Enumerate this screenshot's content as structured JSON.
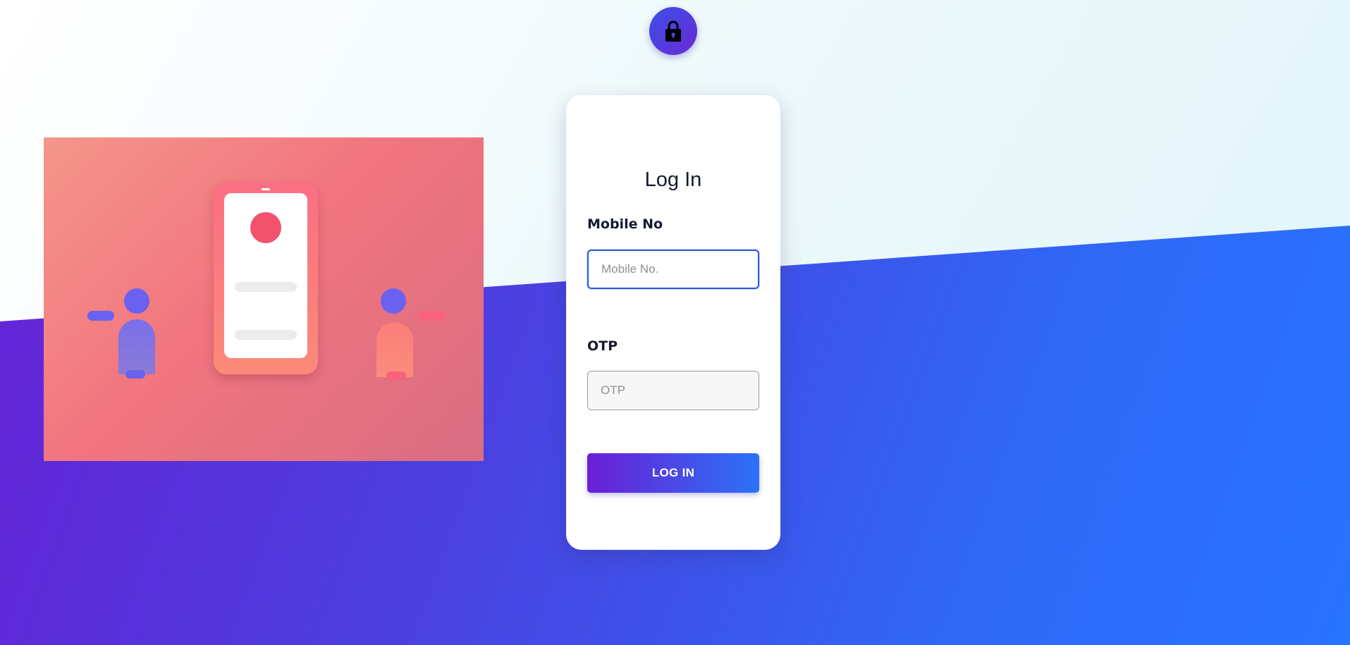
{
  "lock_icon": "lock-icon",
  "illustration": {
    "description_icon": "two-people-phone-illustration"
  },
  "login_card": {
    "title": "Log In",
    "mobile_label": "Mobile No",
    "mobile_placeholder": "Mobile No.",
    "mobile_value": "",
    "otp_label": "OTP",
    "otp_placeholder": "OTP",
    "otp_value": "",
    "submit_label": "LOG IN"
  },
  "colors": {
    "accent_start": "#6a1fd6",
    "accent_end": "#2b72f7",
    "focus_border": "#2c5bd9",
    "illustration_bg": "#f2757f"
  }
}
